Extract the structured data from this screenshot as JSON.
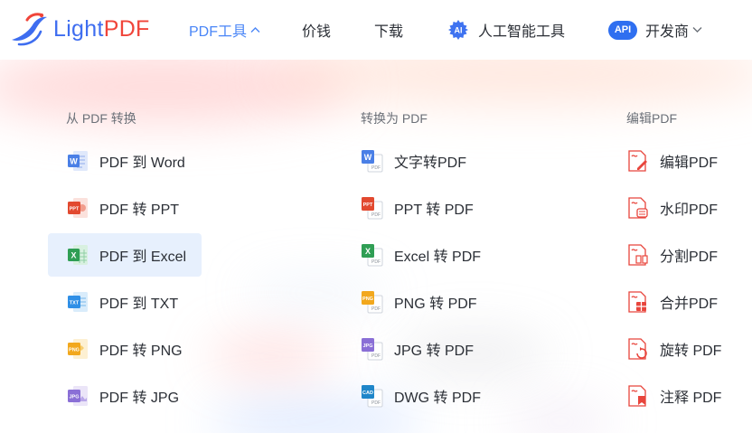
{
  "header": {
    "logo": {
      "light": "Light",
      "pdf": "PDF"
    },
    "nav": {
      "pdf_tools": "PDF工具",
      "price": "价钱",
      "download": "下载",
      "ai_tools": "人工智能工具",
      "ai_badge": "AI",
      "developers": "开发商",
      "api_badge": "API"
    }
  },
  "menu": {
    "col1": {
      "title": "从 PDF 转换",
      "items": [
        {
          "label": "PDF 到 Word",
          "icon": "word-icon",
          "color": "#4a7fe6"
        },
        {
          "label": "PDF 转 PPT",
          "icon": "ppt-icon",
          "color": "#e2492f"
        },
        {
          "label": "PDF 到 Excel",
          "icon": "excel-icon",
          "color": "#2f9e54"
        },
        {
          "label": "PDF 到 TXT",
          "icon": "txt-icon",
          "color": "#2f8fe6"
        },
        {
          "label": "PDF 转 PNG",
          "icon": "png-icon",
          "color": "#f2a81d"
        },
        {
          "label": "PDF 转 JPG",
          "icon": "jpg-icon",
          "color": "#8a6fd6"
        }
      ]
    },
    "col2": {
      "title": "转换为 PDF",
      "items": [
        {
          "label": "文字转PDF",
          "icon": "word-to-pdf-icon",
          "color": "#4a7fe6"
        },
        {
          "label": "PPT 转 PDF",
          "icon": "ppt-to-pdf-icon",
          "color": "#e2492f"
        },
        {
          "label": "Excel 转 PDF",
          "icon": "excel-to-pdf-icon",
          "color": "#2f9e54"
        },
        {
          "label": "PNG 转 PDF",
          "icon": "png-to-pdf-icon",
          "color": "#f2a81d"
        },
        {
          "label": "JPG 转 PDF",
          "icon": "jpg-to-pdf-icon",
          "color": "#8a6fd6"
        },
        {
          "label": "DWG 转 PDF",
          "icon": "dwg-to-pdf-icon",
          "color": "#1f86c9"
        }
      ]
    },
    "col3": {
      "title": "编辑PDF",
      "items": [
        {
          "label": "编辑PDF",
          "icon": "edit-pdf-icon",
          "color": "#e8453c"
        },
        {
          "label": "水印PDF",
          "icon": "watermark-pdf-icon",
          "color": "#e8453c"
        },
        {
          "label": "分割PDF",
          "icon": "split-pdf-icon",
          "color": "#e8453c"
        },
        {
          "label": "合并PDF",
          "icon": "merge-pdf-icon",
          "color": "#e8453c"
        },
        {
          "label": "旋转 PDF",
          "icon": "rotate-pdf-icon",
          "color": "#e8453c"
        },
        {
          "label": "注释 PDF",
          "icon": "annotate-pdf-icon",
          "color": "#e8453c"
        }
      ]
    }
  },
  "theme": {
    "accent": "#4a86f7",
    "logo_blue": "#3e6df0",
    "logo_red": "#f0453a",
    "highlight_bg": "#e7f0fd"
  }
}
